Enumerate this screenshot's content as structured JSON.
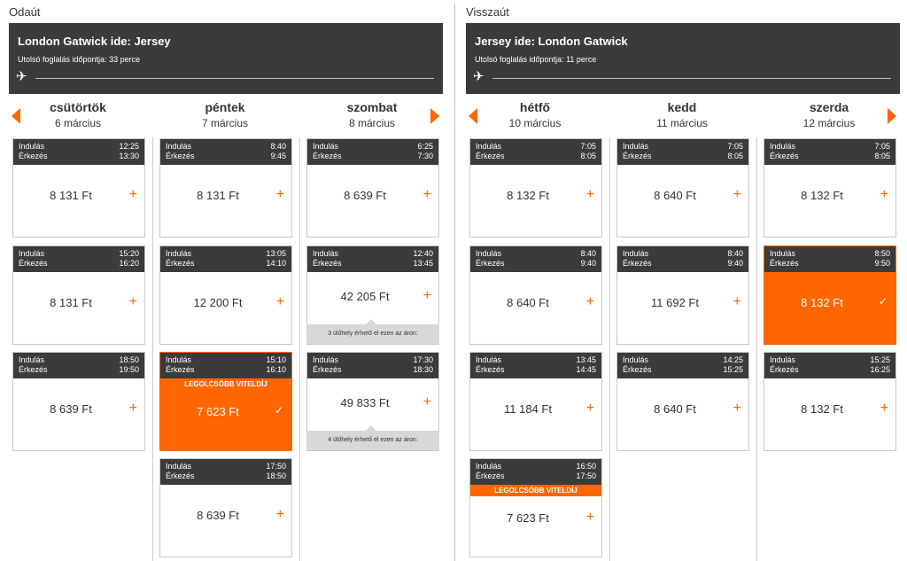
{
  "outbound": {
    "section_label": "Odaút",
    "route_title": "London Gatwick ide: Jersey",
    "booking_note": "Utolsó foglalás időpontja: 33 perce",
    "days": [
      {
        "name": "csütörtök",
        "date": "6 március",
        "flights": [
          {
            "dep_label": "Indulás",
            "dep": "12:25",
            "arr_label": "Érkezés",
            "arr": "13:30",
            "price": "8 131 Ft"
          },
          {
            "dep_label": "Indulás",
            "dep": "15:20",
            "arr_label": "Érkezés",
            "arr": "16:20",
            "price": "8 131 Ft"
          },
          {
            "dep_label": "Indulás",
            "dep": "18:50",
            "arr_label": "Érkezés",
            "arr": "19:50",
            "price": "8 639 Ft"
          }
        ]
      },
      {
        "name": "péntek",
        "date": "7 március",
        "flights": [
          {
            "dep_label": "Indulás",
            "dep": "8:40",
            "arr_label": "Érkezés",
            "arr": "9:45",
            "price": "8 131 Ft"
          },
          {
            "dep_label": "Indulás",
            "dep": "13:05",
            "arr_label": "Érkezés",
            "arr": "14:10",
            "price": "12 200 Ft"
          },
          {
            "dep_label": "Indulás",
            "dep": "15:10",
            "arr_label": "Érkezés",
            "arr": "16:10",
            "price": "7 623 Ft",
            "badge": "LEGOLCSÓBB VITELDÍJ"
          },
          {
            "dep_label": "Indulás",
            "dep": "17:50",
            "arr_label": "Érkezés",
            "arr": "18:50",
            "price": "8 639 Ft"
          }
        ]
      },
      {
        "name": "szombat",
        "date": "8 március",
        "flights": [
          {
            "dep_label": "Indulás",
            "dep": "6:25",
            "arr_label": "Érkezés",
            "arr": "7:30",
            "price": "8 639 Ft"
          },
          {
            "dep_label": "Indulás",
            "dep": "12:40",
            "arr_label": "Érkezés",
            "arr": "13:45",
            "price": "42 205 Ft",
            "seats": "3 ülőhely érhető el ezen az áron:"
          },
          {
            "dep_label": "Indulás",
            "dep": "17:30",
            "arr_label": "Érkezés",
            "arr": "18:30",
            "price": "49 833 Ft",
            "seats": "4 ülőhely érhető el ezen az áron:"
          }
        ]
      }
    ]
  },
  "return": {
    "section_label": "Visszaút",
    "route_title": "Jersey ide: London Gatwick",
    "booking_note": "Utolsó foglalás időpontja: 11 perce",
    "days": [
      {
        "name": "hétfő",
        "date": "10 március",
        "flights": [
          {
            "dep_label": "Indulás",
            "dep": "7:05",
            "arr_label": "Érkezés",
            "arr": "8:05",
            "price": "8 132 Ft"
          },
          {
            "dep_label": "Indulás",
            "dep": "8:40",
            "arr_label": "Érkezés",
            "arr": "9:40",
            "price": "8 640 Ft"
          },
          {
            "dep_label": "Indulás",
            "dep": "13:45",
            "arr_label": "Érkezés",
            "arr": "14:45",
            "price": "11 184 Ft"
          },
          {
            "dep_label": "Indulás",
            "dep": "16:50",
            "arr_label": "Érkezés",
            "arr": "17:50",
            "price": "7 623 Ft",
            "badge": "LEGOLCSÓBB VITELDÍJ"
          }
        ]
      },
      {
        "name": "kedd",
        "date": "11 március",
        "flights": [
          {
            "dep_label": "Indulás",
            "dep": "7:05",
            "arr_label": "Érkezés",
            "arr": "8:05",
            "price": "8 640 Ft"
          },
          {
            "dep_label": "Indulás",
            "dep": "8:40",
            "arr_label": "Érkezés",
            "arr": "9:40",
            "price": "11 692 Ft"
          },
          {
            "dep_label": "Indulás",
            "dep": "14:25",
            "arr_label": "Érkezés",
            "arr": "15:25",
            "price": "8 640 Ft"
          }
        ]
      },
      {
        "name": "szerda",
        "date": "12 március",
        "flights": [
          {
            "dep_label": "Indulás",
            "dep": "7:05",
            "arr_label": "Érkezés",
            "arr": "8:05",
            "price": "8 132 Ft"
          },
          {
            "dep_label": "Indulás",
            "dep": "8:50",
            "arr_label": "Érkezés",
            "arr": "9:50",
            "price": "8 132 Ft"
          },
          {
            "dep_label": "Indulás",
            "dep": "15:25",
            "arr_label": "Érkezés",
            "arr": "16:25",
            "price": "8 132 Ft"
          }
        ]
      }
    ]
  },
  "selected": {
    "outbound": "15:10",
    "return": "8:50"
  },
  "colors": {
    "accent": "#ff6600",
    "header_bg": "#3b3b3b"
  },
  "icons": {
    "plane": "plane-icon",
    "prev": "chevron-left-icon",
    "next": "chevron-right-icon",
    "add": "plus-icon",
    "selected": "check-icon"
  }
}
